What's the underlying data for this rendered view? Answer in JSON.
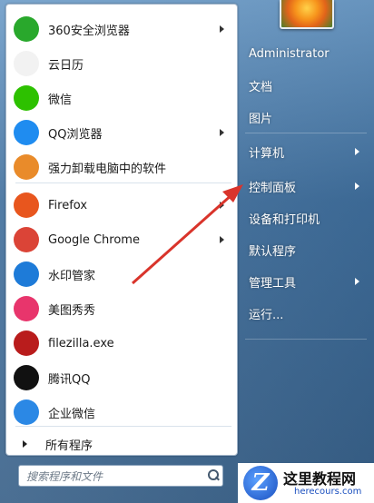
{
  "programs": [
    {
      "label": "360安全浏览器",
      "icon": "360-browser-icon",
      "has_arrow": true,
      "color": "#29a82c"
    },
    {
      "label": "云日历",
      "icon": "calendar-doc-icon",
      "has_arrow": false,
      "color": "#f2f2f2"
    },
    {
      "label": "微信",
      "icon": "wechat-icon",
      "has_arrow": false,
      "color": "#2dc100"
    },
    {
      "label": "QQ浏览器",
      "icon": "qq-browser-icon",
      "has_arrow": true,
      "color": "#1f8cf0"
    },
    {
      "label": "强力卸载电脑中的软件",
      "icon": "uninstall-box-icon",
      "has_arrow": false,
      "color": "#e98b2a"
    },
    {
      "label": "Firefox",
      "icon": "firefox-icon",
      "has_arrow": true,
      "color": "#e8561e"
    },
    {
      "label": "Google Chrome",
      "icon": "chrome-icon",
      "has_arrow": true,
      "color": "#db4437"
    },
    {
      "label": "水印管家",
      "icon": "watermark-user-icon",
      "has_arrow": false,
      "color": "#1e7bd8"
    },
    {
      "label": "美图秀秀",
      "icon": "meitu-icon",
      "has_arrow": false,
      "color": "#e8356c"
    },
    {
      "label": "filezilla.exe",
      "icon": "filezilla-icon",
      "has_arrow": false,
      "color": "#b91c1c"
    },
    {
      "label": "腾讯QQ",
      "icon": "qq-penguin-icon",
      "has_arrow": false,
      "color": "#111111"
    },
    {
      "label": "企业微信",
      "icon": "wecom-icon",
      "has_arrow": false,
      "color": "#2b88e5"
    }
  ],
  "all_programs_label": "所有程序",
  "search": {
    "placeholder": "搜索程序和文件"
  },
  "right_items": [
    {
      "label": "Administrator",
      "has_arrow": false
    },
    {
      "label": "文档",
      "has_arrow": false
    },
    {
      "label": "图片",
      "has_arrow": false
    },
    {
      "label": "计算机",
      "has_arrow": true
    },
    {
      "label": "控制面板",
      "has_arrow": true
    },
    {
      "label": "设备和打印机",
      "has_arrow": false
    },
    {
      "label": "默认程序",
      "has_arrow": false
    },
    {
      "label": "管理工具",
      "has_arrow": true
    },
    {
      "label": "运行...",
      "has_arrow": false
    }
  ],
  "watermark": {
    "title": "这里教程网",
    "subtitle": "herecours.com"
  },
  "colors": {
    "annotation_arrow": "#d9342b"
  }
}
